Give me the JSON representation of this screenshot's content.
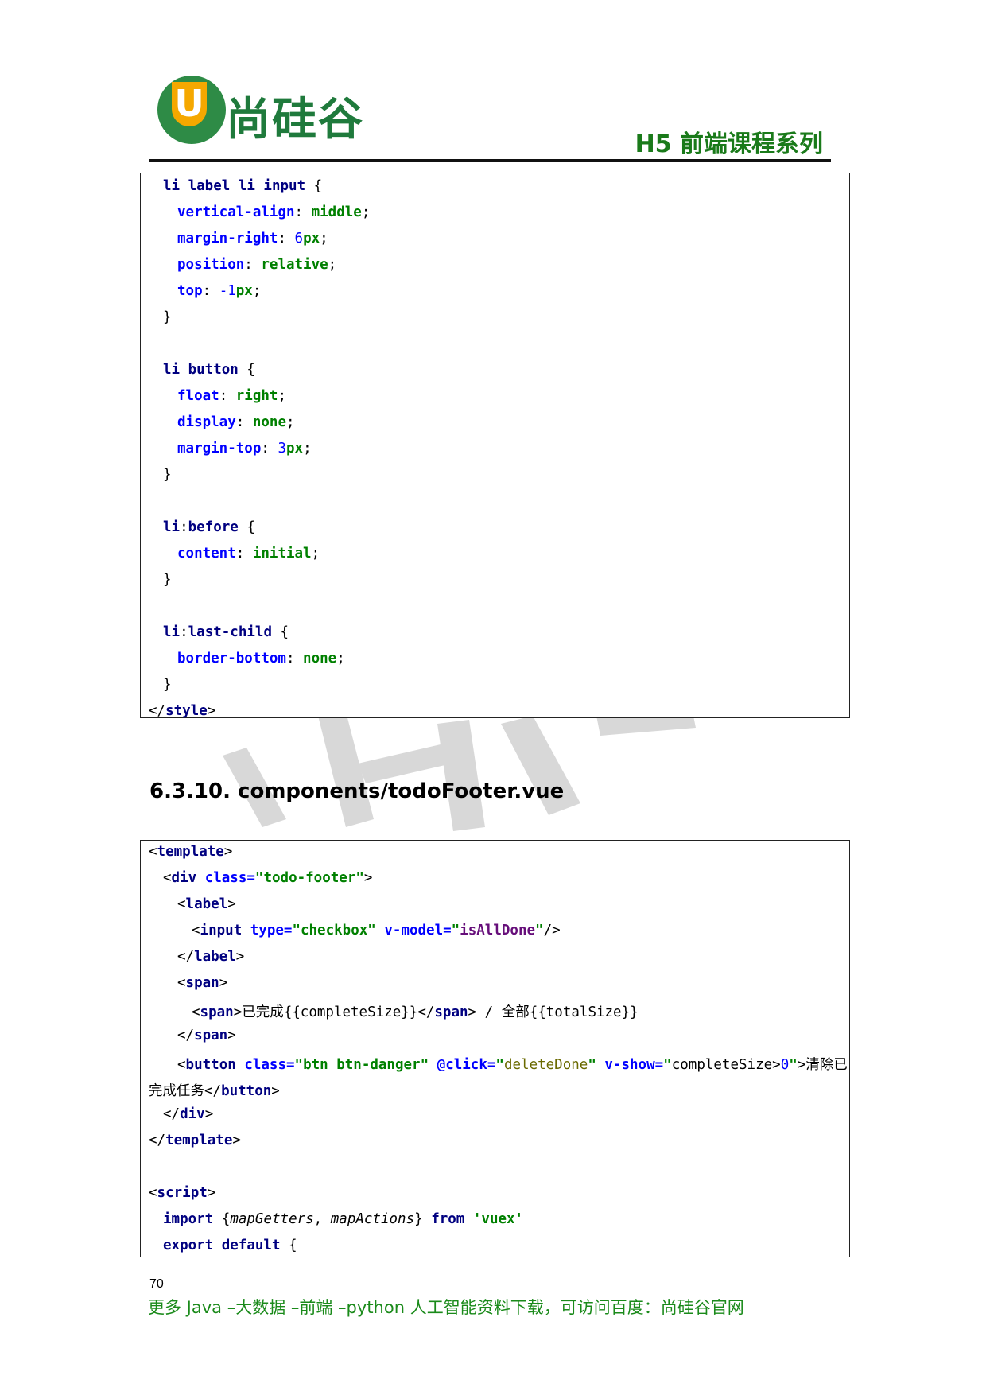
{
  "header": {
    "logo_text": "尚硅谷",
    "logo_letter": "U",
    "series": "H5 前端课程系列"
  },
  "code_block_1": {
    "lines": [
      {
        "parts": [
          [
            "kw",
            "li label li input"
          ],
          [
            "plain",
            " {"
          ]
        ]
      },
      {
        "parts": [
          [
            "prop",
            "vertical-align"
          ],
          [
            "plain",
            ": "
          ],
          [
            "val",
            "middle"
          ],
          [
            "plain",
            ";"
          ]
        ]
      },
      {
        "parts": [
          [
            "prop",
            "margin-right"
          ],
          [
            "plain",
            ": "
          ],
          [
            "num",
            "6"
          ],
          [
            "val",
            "px"
          ],
          [
            "plain",
            ";"
          ]
        ]
      },
      {
        "parts": [
          [
            "prop",
            "position"
          ],
          [
            "plain",
            ": "
          ],
          [
            "val",
            "relative"
          ],
          [
            "plain",
            ";"
          ]
        ]
      },
      {
        "parts": [
          [
            "prop",
            "top"
          ],
          [
            "plain",
            ": "
          ],
          [
            "num",
            "-1"
          ],
          [
            "val",
            "px"
          ],
          [
            "plain",
            ";"
          ]
        ]
      },
      {
        "parts": [
          [
            "plain",
            "}"
          ]
        ]
      },
      {
        "parts": []
      },
      {
        "parts": [
          [
            "kw",
            "li button"
          ],
          [
            "plain",
            " {"
          ]
        ]
      },
      {
        "parts": [
          [
            "prop",
            "float"
          ],
          [
            "plain",
            ": "
          ],
          [
            "val",
            "right"
          ],
          [
            "plain",
            ";"
          ]
        ]
      },
      {
        "parts": [
          [
            "prop",
            "display"
          ],
          [
            "plain",
            ": "
          ],
          [
            "val",
            "none"
          ],
          [
            "plain",
            ";"
          ]
        ]
      },
      {
        "parts": [
          [
            "prop",
            "margin-top"
          ],
          [
            "plain",
            ": "
          ],
          [
            "num",
            "3"
          ],
          [
            "val",
            "px"
          ],
          [
            "plain",
            ";"
          ]
        ]
      },
      {
        "parts": [
          [
            "plain",
            "}"
          ]
        ]
      },
      {
        "parts": []
      },
      {
        "parts": [
          [
            "kw",
            "li"
          ],
          [
            "plain",
            ":"
          ],
          [
            "kw",
            "before"
          ],
          [
            "plain",
            " {"
          ]
        ]
      },
      {
        "parts": [
          [
            "prop",
            "content"
          ],
          [
            "plain",
            ": "
          ],
          [
            "val",
            "initial"
          ],
          [
            "plain",
            ";"
          ]
        ]
      },
      {
        "parts": [
          [
            "plain",
            "}"
          ]
        ]
      },
      {
        "parts": []
      },
      {
        "parts": [
          [
            "kw",
            "li"
          ],
          [
            "plain",
            ":"
          ],
          [
            "kw",
            "last-child"
          ],
          [
            "plain",
            " {"
          ]
        ]
      },
      {
        "parts": [
          [
            "prop",
            "border-bottom"
          ],
          [
            "plain",
            ": "
          ],
          [
            "val",
            "none"
          ],
          [
            "plain",
            ";"
          ]
        ]
      },
      {
        "parts": [
          [
            "plain",
            "}"
          ]
        ]
      },
      {
        "parts": [
          [
            "plain",
            "</"
          ],
          [
            "kw",
            "style"
          ],
          [
            "plain",
            ">"
          ]
        ]
      }
    ]
  },
  "section_heading": "6.3.10. components/todoFooter.vue",
  "code_block_2": {
    "lines": [
      {
        "parts": [
          [
            "plain",
            "<"
          ],
          [
            "kw",
            "template"
          ],
          [
            "plain",
            ">"
          ]
        ]
      },
      {
        "parts": [
          [
            "plain",
            "<"
          ],
          [
            "kw",
            "div "
          ],
          [
            "attr",
            "class="
          ],
          [
            "str",
            "\"todo-footer\""
          ],
          [
            "plain",
            ">"
          ]
        ]
      },
      {
        "parts": [
          [
            "plain",
            "<"
          ],
          [
            "kw",
            "label"
          ],
          [
            "plain",
            ">"
          ]
        ]
      },
      {
        "parts": [
          [
            "plain",
            "<"
          ],
          [
            "kw",
            "input "
          ],
          [
            "attr",
            "type="
          ],
          [
            "str",
            "\"checkbox\" "
          ],
          [
            "attr",
            "v-model="
          ],
          [
            "str",
            "\""
          ],
          [
            "str2",
            "isAllDone"
          ],
          [
            "str",
            "\""
          ],
          [
            "plain",
            "/>"
          ]
        ]
      },
      {
        "parts": [
          [
            "plain",
            "</"
          ],
          [
            "kw",
            "label"
          ],
          [
            "plain",
            ">"
          ]
        ]
      },
      {
        "parts": [
          [
            "plain",
            "<"
          ],
          [
            "kw",
            "span"
          ],
          [
            "plain",
            ">"
          ]
        ]
      },
      {
        "parts": [
          [
            "plain",
            "<"
          ],
          [
            "kw",
            "span"
          ],
          [
            "plain",
            ">已完成{{completeSize}}</"
          ],
          [
            "kw",
            "span"
          ],
          [
            "plain",
            "> / 全部{{totalSize}}"
          ]
        ]
      },
      {
        "parts": [
          [
            "plain",
            "</"
          ],
          [
            "kw",
            "span"
          ],
          [
            "plain",
            ">"
          ]
        ]
      },
      {
        "parts": [
          [
            "plain",
            "<"
          ],
          [
            "kw",
            "button "
          ],
          [
            "attr",
            "class="
          ],
          [
            "str",
            "\"btn btn-danger\" "
          ],
          [
            "attr",
            "@click="
          ],
          [
            "str",
            "\""
          ],
          [
            "dim",
            "deleteDone"
          ],
          [
            "str",
            "\" "
          ],
          [
            "attr",
            "v-show="
          ],
          [
            "str",
            "\""
          ],
          [
            "plain",
            "completeSize>"
          ],
          [
            "num",
            "0"
          ],
          [
            "str",
            "\""
          ],
          [
            "plain",
            ">清除已"
          ]
        ]
      },
      {
        "parts": [
          [
            "plain",
            "完成任务</"
          ],
          [
            "kw",
            "button"
          ],
          [
            "plain",
            ">"
          ]
        ]
      },
      {
        "parts": [
          [
            "plain",
            "</"
          ],
          [
            "kw",
            "div"
          ],
          [
            "plain",
            ">"
          ]
        ]
      },
      {
        "parts": [
          [
            "plain",
            "</"
          ],
          [
            "kw",
            "template"
          ],
          [
            "plain",
            ">"
          ]
        ]
      },
      {
        "parts": []
      },
      {
        "parts": [
          [
            "plain",
            "<"
          ],
          [
            "kw",
            "script"
          ],
          [
            "plain",
            ">"
          ]
        ]
      },
      {
        "parts": [
          [
            "kw",
            "import "
          ],
          [
            "plain",
            "{"
          ],
          [
            "ital",
            "mapGetters"
          ],
          [
            "plain",
            ", "
          ],
          [
            "ital",
            "mapActions"
          ],
          [
            "plain",
            "} "
          ],
          [
            "kw",
            "from "
          ],
          [
            "str",
            "'vuex'"
          ]
        ]
      },
      {
        "parts": [
          [
            "kw",
            "export default "
          ],
          [
            "plain",
            "{"
          ]
        ]
      }
    ]
  },
  "page_number": "70",
  "footer_text": "更多 Java –大数据 –前端 –python 人工智能资料下载，可访问百度：尚硅谷官网"
}
